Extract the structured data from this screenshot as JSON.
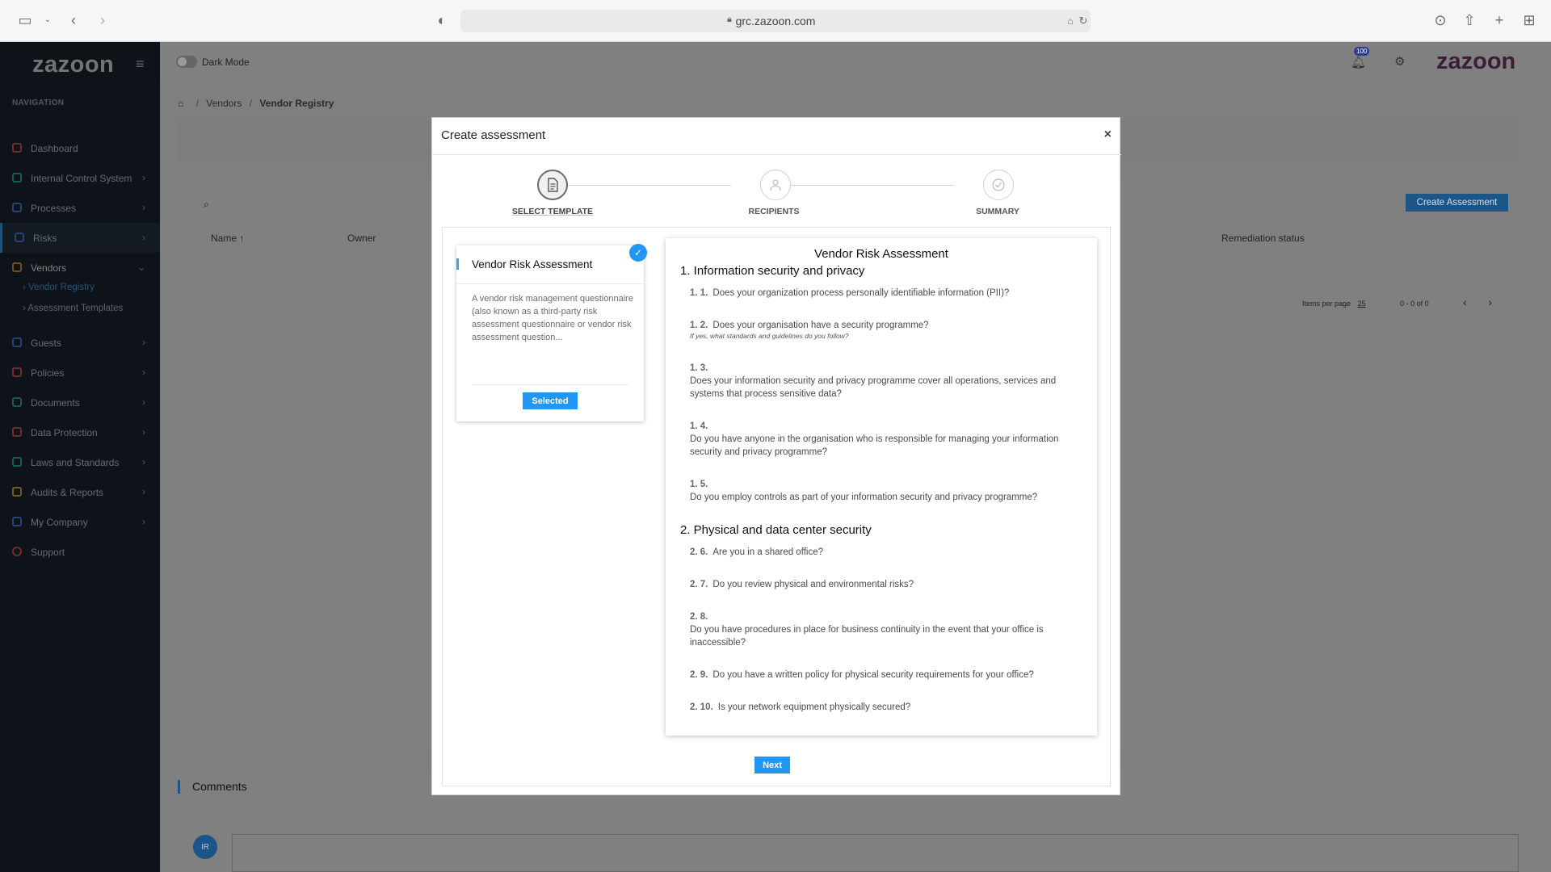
{
  "browser": {
    "url": "grc.zazoon.com"
  },
  "sidebar": {
    "logo": "zazoon",
    "heading": "NAVIGATION",
    "items": [
      {
        "label": "Dashboard",
        "color": "#e05a5a"
      },
      {
        "label": "Internal Control System",
        "color": "#2eb8a8"
      },
      {
        "label": "Processes",
        "color": "#4a86e8"
      },
      {
        "label": "Risks",
        "color": "#4a86e8"
      },
      {
        "label": "Vendors",
        "color": "#e89a3a"
      },
      {
        "label": "Guests",
        "color": "#4a86e8"
      },
      {
        "label": "Policies",
        "color": "#e05a5a"
      },
      {
        "label": "Documents",
        "color": "#2eb8a8"
      },
      {
        "label": "Data Protection",
        "color": "#e05a5a"
      },
      {
        "label": "Laws and Standards",
        "color": "#2eb8a8"
      },
      {
        "label": "Audits & Reports",
        "color": "#e8b83a"
      },
      {
        "label": "My Company",
        "color": "#4a86e8"
      },
      {
        "label": "Support",
        "color": "#e05a5a"
      }
    ],
    "sub_items": [
      "Vendor Registry",
      "Assessment Templates"
    ]
  },
  "topbar": {
    "dark_mode_label": "Dark Mode",
    "notification_count": "100",
    "brand": "zazoon"
  },
  "breadcrumb": {
    "vendors": "Vendors",
    "current": "Vendor Registry"
  },
  "table": {
    "create_button": "Create Assessment",
    "columns": [
      "Name",
      "Owner",
      "Remediation status"
    ],
    "items_per_page_label": "Items per page",
    "items_per_page": "25",
    "range": "0 - 0 of 0"
  },
  "comments": {
    "title": "Comments",
    "avatar_initials": "IR"
  },
  "modal": {
    "title": "Create assessment",
    "close": "×",
    "steps": [
      "SELECT TEMPLATE",
      "RECIPIENTS",
      "SUMMARY"
    ],
    "template": {
      "title": "Vendor Risk Assessment",
      "description": "A vendor risk management questionnaire (also known as a third-party risk assessment questionnaire or vendor risk assessment question...",
      "button": "Selected"
    },
    "preview": {
      "title": "Vendor Risk Assessment",
      "section1": "1. Information security and privacy",
      "section2": "2. Physical and data center security",
      "q1_1": {
        "num": "1. 1.",
        "text": "Does your organization process personally identifiable information (PII)?"
      },
      "q1_2": {
        "num": "1. 2.",
        "text": "Does your organisation have a security programme?",
        "hint": "If yes, what standards and guidelines do you follow?"
      },
      "q1_3": {
        "num": "1. 3.",
        "text": "Does your information security and privacy programme cover all operations, services and systems that process sensitive data?"
      },
      "q1_4": {
        "num": "1. 4.",
        "text": "Do you have anyone in the organisation who is responsible for managing your information security and privacy programme?"
      },
      "q1_5": {
        "num": "1. 5.",
        "text": "Do you employ controls as part of your information security and privacy programme?"
      },
      "q2_6": {
        "num": "2. 6.",
        "text": "Are you in a shared office?"
      },
      "q2_7": {
        "num": "2. 7.",
        "text": "Do you review physical and environmental risks?"
      },
      "q2_8": {
        "num": "2. 8.",
        "text": "Do you have procedures in place for business continuity in the event that your office is inaccessible?"
      },
      "q2_9": {
        "num": "2. 9.",
        "text": "Do you have a written policy for physical security requirements for your office?"
      },
      "q2_10": {
        "num": "2. 10.",
        "text": "Is your network equipment physically secured?"
      }
    },
    "next_button": "Next"
  },
  "colors": {
    "accent": "#2196f3",
    "sidebar_bg": "#1b2633"
  }
}
